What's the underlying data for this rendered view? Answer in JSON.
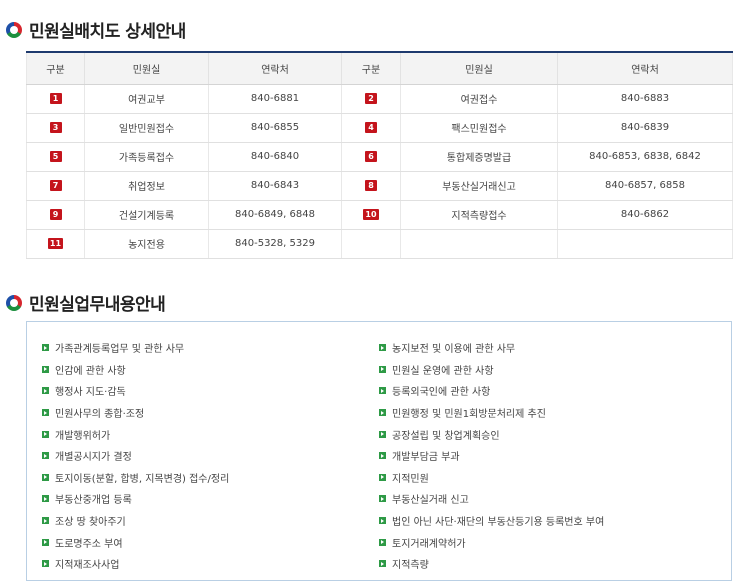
{
  "sections": {
    "office_title": "민원실배치도 상세안내",
    "duty_title": "민원실업무내용안내"
  },
  "office_table": {
    "headers": [
      "구분",
      "민원실",
      "연락처",
      "구분",
      "민원실",
      "연락처"
    ],
    "rows": [
      [
        {
          "num": "1",
          "name": "여권교부",
          "phone": "840-6881"
        },
        {
          "num": "2",
          "name": "여권접수",
          "phone": "840-6883"
        }
      ],
      [
        {
          "num": "3",
          "name": "일반민원접수",
          "phone": "840-6855"
        },
        {
          "num": "4",
          "name": "팩스민원접수",
          "phone": "840-6839"
        }
      ],
      [
        {
          "num": "5",
          "name": "가족등록접수",
          "phone": "840-6840"
        },
        {
          "num": "6",
          "name": "통합제증명발급",
          "phone": "840-6853, 6838, 6842"
        }
      ],
      [
        {
          "num": "7",
          "name": "취업정보",
          "phone": "840-6843"
        },
        {
          "num": "8",
          "name": "부동산실거래신고",
          "phone": "840-6857, 6858"
        }
      ],
      [
        {
          "num": "9",
          "name": "건설기계등록",
          "phone": "840-6849, 6848"
        },
        {
          "num": "10",
          "name": "지적측량접수",
          "phone": "840-6862"
        }
      ],
      [
        {
          "num": "11",
          "name": "농지전용",
          "phone": "840-5328, 5329"
        },
        {
          "num": "",
          "name": "",
          "phone": ""
        }
      ]
    ],
    "badge_color": "#c4141c",
    "header_border_color": "#1e3a6e"
  },
  "duties": {
    "left": [
      "가족관계등록업무 및 관한 사무",
      "인감에 관한 사항",
      "행정사 지도·감독",
      "민원사무의 종합·조정",
      "개발행위허가",
      "개별공시지가 결정",
      "토지이동(분할, 합병, 지목변경) 접수/정리",
      "부동산중개업 등록",
      "조상 땅 찾아주기",
      "도로명주소 부여",
      "지적재조사사업"
    ],
    "right": [
      "농지보전 및 이용에 관한 사무",
      "민원실 운영에 관한 사항",
      "등록외국인에 관한 사항",
      "민원행정 및 민원1회방문처리제 추진",
      "공장설립 및 창업계획승인",
      "개발부담금 부과",
      "지적민원",
      "부동산실거래 신고",
      "법인 아닌 사단·재단의 부동산등기용 등록번호 부여",
      "토지거래계약허가",
      "지적측량"
    ],
    "bullet_color": "#2e9a46",
    "box_border_color": "#b9cfe4"
  }
}
